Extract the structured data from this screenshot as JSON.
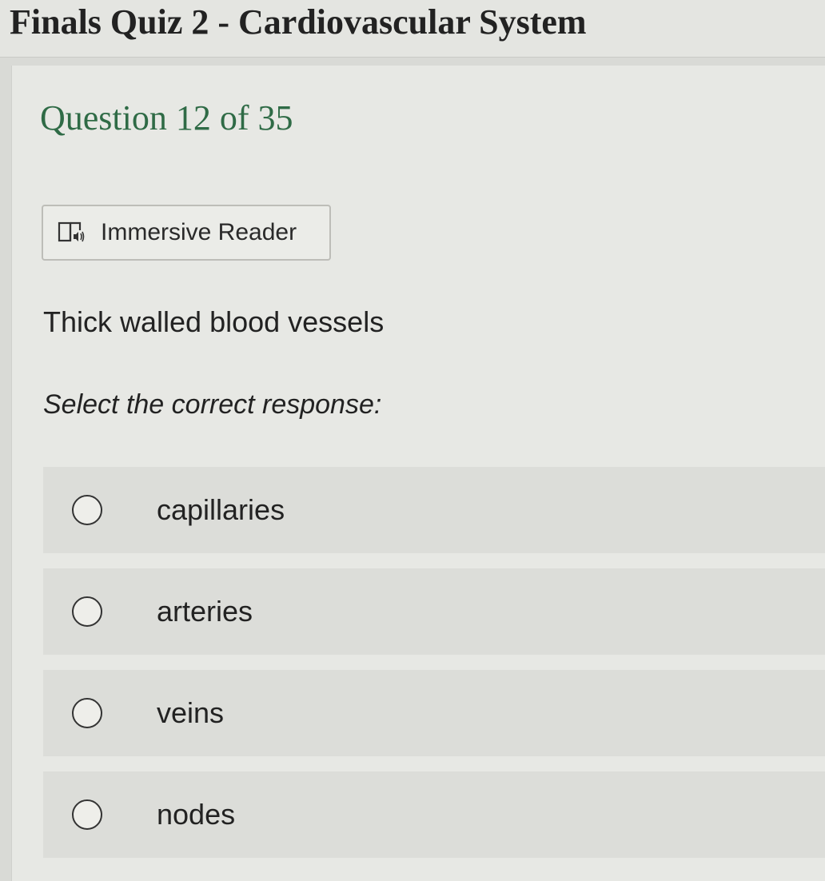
{
  "header": {
    "quiz_title": "Finals Quiz 2 - Cardiovascular System"
  },
  "question": {
    "heading": "Question 12 of 35",
    "immersive_reader_label": "Immersive Reader",
    "text": "Thick walled blood vessels",
    "instruction": "Select the correct response:"
  },
  "options": [
    {
      "label": "capillaries"
    },
    {
      "label": "arteries"
    },
    {
      "label": "veins"
    },
    {
      "label": "nodes"
    }
  ],
  "colors": {
    "heading_green": "#2f6b46",
    "background": "#e7e8e4",
    "option_background": "#dcddd9"
  },
  "icons": {
    "immersive_reader": "immersive-reader-icon",
    "radio": "radio-unchecked-icon"
  }
}
